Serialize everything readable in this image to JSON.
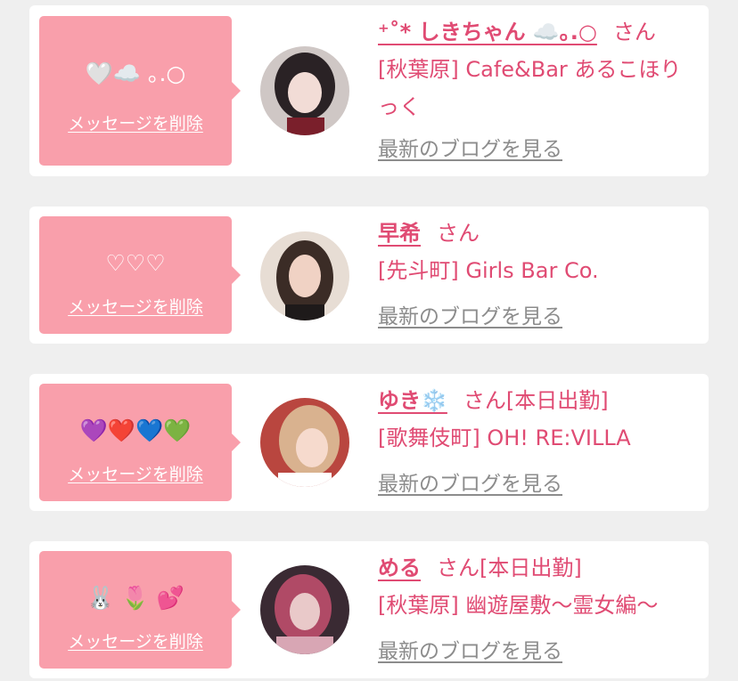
{
  "items": [
    {
      "message": "🤍☁️ ｡.○",
      "delete_label": "メッセージを削除",
      "name": "⁺˚* しきちゃん ☁️｡.○",
      "honorific": "さん",
      "status": "",
      "shop": "[秋葉原] Cafe&Bar あるこほりっく",
      "blog_label": "最新のブログを見る",
      "avatar_colors": [
        "#cfc7c5",
        "#2a2225",
        "#f2dcd6"
      ]
    },
    {
      "message": "♡♡♡",
      "delete_label": "メッセージを削除",
      "name": "早希",
      "honorific": "さん",
      "status": "",
      "shop": "[先斗町] Girls Bar Co.",
      "blog_label": "最新のブログを見る",
      "avatar_colors": [
        "#e7ddd4",
        "#3b2c26",
        "#f0d2c4"
      ]
    },
    {
      "message": "💜❤️💙💚",
      "delete_label": "メッセージを削除",
      "name": "ゆき❄️",
      "honorific": "さん",
      "status": "[本日出勤]",
      "shop": "[歌舞伎町] OH! RE:VILLA",
      "blog_label": "最新のブログを見る",
      "avatar_colors": [
        "#b9463f",
        "#d9b28f",
        "#f6dacd"
      ]
    },
    {
      "message": "🐰 🌷 💕",
      "delete_label": "メッセージを削除",
      "name": "める",
      "honorific": "さん",
      "status": "[本日出勤]",
      "shop": "[秋葉原] 幽遊屋敷〜霊女編〜",
      "blog_label": "最新のブログを見る",
      "avatar_colors": [
        "#3a2a33",
        "#b04a66",
        "#e9c9c9"
      ]
    }
  ],
  "colors": {
    "background": "#efefef",
    "bubble": "#f99fab",
    "name": "#e04b73",
    "blog_link": "#8c8c8c"
  }
}
